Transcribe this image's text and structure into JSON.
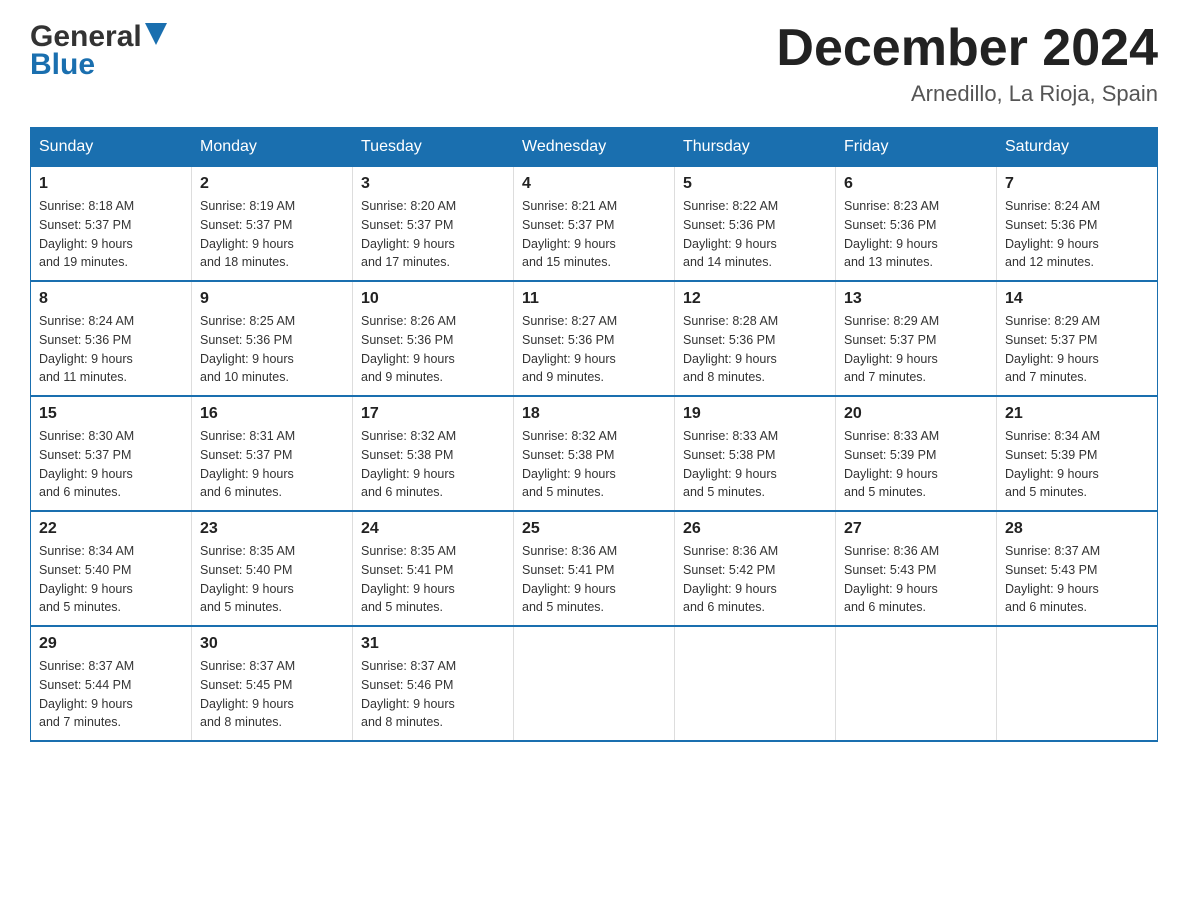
{
  "logo": {
    "general": "General",
    "blue": "Blue",
    "tagline": ""
  },
  "header": {
    "month_year": "December 2024",
    "location": "Arnedillo, La Rioja, Spain"
  },
  "weekdays": [
    "Sunday",
    "Monday",
    "Tuesday",
    "Wednesday",
    "Thursday",
    "Friday",
    "Saturday"
  ],
  "weeks": [
    [
      {
        "day": "1",
        "sunrise": "8:18 AM",
        "sunset": "5:37 PM",
        "daylight": "9 hours and 19 minutes."
      },
      {
        "day": "2",
        "sunrise": "8:19 AM",
        "sunset": "5:37 PM",
        "daylight": "9 hours and 18 minutes."
      },
      {
        "day": "3",
        "sunrise": "8:20 AM",
        "sunset": "5:37 PM",
        "daylight": "9 hours and 17 minutes."
      },
      {
        "day": "4",
        "sunrise": "8:21 AM",
        "sunset": "5:37 PM",
        "daylight": "9 hours and 15 minutes."
      },
      {
        "day": "5",
        "sunrise": "8:22 AM",
        "sunset": "5:36 PM",
        "daylight": "9 hours and 14 minutes."
      },
      {
        "day": "6",
        "sunrise": "8:23 AM",
        "sunset": "5:36 PM",
        "daylight": "9 hours and 13 minutes."
      },
      {
        "day": "7",
        "sunrise": "8:24 AM",
        "sunset": "5:36 PM",
        "daylight": "9 hours and 12 minutes."
      }
    ],
    [
      {
        "day": "8",
        "sunrise": "8:24 AM",
        "sunset": "5:36 PM",
        "daylight": "9 hours and 11 minutes."
      },
      {
        "day": "9",
        "sunrise": "8:25 AM",
        "sunset": "5:36 PM",
        "daylight": "9 hours and 10 minutes."
      },
      {
        "day": "10",
        "sunrise": "8:26 AM",
        "sunset": "5:36 PM",
        "daylight": "9 hours and 9 minutes."
      },
      {
        "day": "11",
        "sunrise": "8:27 AM",
        "sunset": "5:36 PM",
        "daylight": "9 hours and 9 minutes."
      },
      {
        "day": "12",
        "sunrise": "8:28 AM",
        "sunset": "5:36 PM",
        "daylight": "9 hours and 8 minutes."
      },
      {
        "day": "13",
        "sunrise": "8:29 AM",
        "sunset": "5:37 PM",
        "daylight": "9 hours and 7 minutes."
      },
      {
        "day": "14",
        "sunrise": "8:29 AM",
        "sunset": "5:37 PM",
        "daylight": "9 hours and 7 minutes."
      }
    ],
    [
      {
        "day": "15",
        "sunrise": "8:30 AM",
        "sunset": "5:37 PM",
        "daylight": "9 hours and 6 minutes."
      },
      {
        "day": "16",
        "sunrise": "8:31 AM",
        "sunset": "5:37 PM",
        "daylight": "9 hours and 6 minutes."
      },
      {
        "day": "17",
        "sunrise": "8:32 AM",
        "sunset": "5:38 PM",
        "daylight": "9 hours and 6 minutes."
      },
      {
        "day": "18",
        "sunrise": "8:32 AM",
        "sunset": "5:38 PM",
        "daylight": "9 hours and 5 minutes."
      },
      {
        "day": "19",
        "sunrise": "8:33 AM",
        "sunset": "5:38 PM",
        "daylight": "9 hours and 5 minutes."
      },
      {
        "day": "20",
        "sunrise": "8:33 AM",
        "sunset": "5:39 PM",
        "daylight": "9 hours and 5 minutes."
      },
      {
        "day": "21",
        "sunrise": "8:34 AM",
        "sunset": "5:39 PM",
        "daylight": "9 hours and 5 minutes."
      }
    ],
    [
      {
        "day": "22",
        "sunrise": "8:34 AM",
        "sunset": "5:40 PM",
        "daylight": "9 hours and 5 minutes."
      },
      {
        "day": "23",
        "sunrise": "8:35 AM",
        "sunset": "5:40 PM",
        "daylight": "9 hours and 5 minutes."
      },
      {
        "day": "24",
        "sunrise": "8:35 AM",
        "sunset": "5:41 PM",
        "daylight": "9 hours and 5 minutes."
      },
      {
        "day": "25",
        "sunrise": "8:36 AM",
        "sunset": "5:41 PM",
        "daylight": "9 hours and 5 minutes."
      },
      {
        "day": "26",
        "sunrise": "8:36 AM",
        "sunset": "5:42 PM",
        "daylight": "9 hours and 6 minutes."
      },
      {
        "day": "27",
        "sunrise": "8:36 AM",
        "sunset": "5:43 PM",
        "daylight": "9 hours and 6 minutes."
      },
      {
        "day": "28",
        "sunrise": "8:37 AM",
        "sunset": "5:43 PM",
        "daylight": "9 hours and 6 minutes."
      }
    ],
    [
      {
        "day": "29",
        "sunrise": "8:37 AM",
        "sunset": "5:44 PM",
        "daylight": "9 hours and 7 minutes."
      },
      {
        "day": "30",
        "sunrise": "8:37 AM",
        "sunset": "5:45 PM",
        "daylight": "9 hours and 8 minutes."
      },
      {
        "day": "31",
        "sunrise": "8:37 AM",
        "sunset": "5:46 PM",
        "daylight": "9 hours and 8 minutes."
      },
      null,
      null,
      null,
      null
    ]
  ]
}
